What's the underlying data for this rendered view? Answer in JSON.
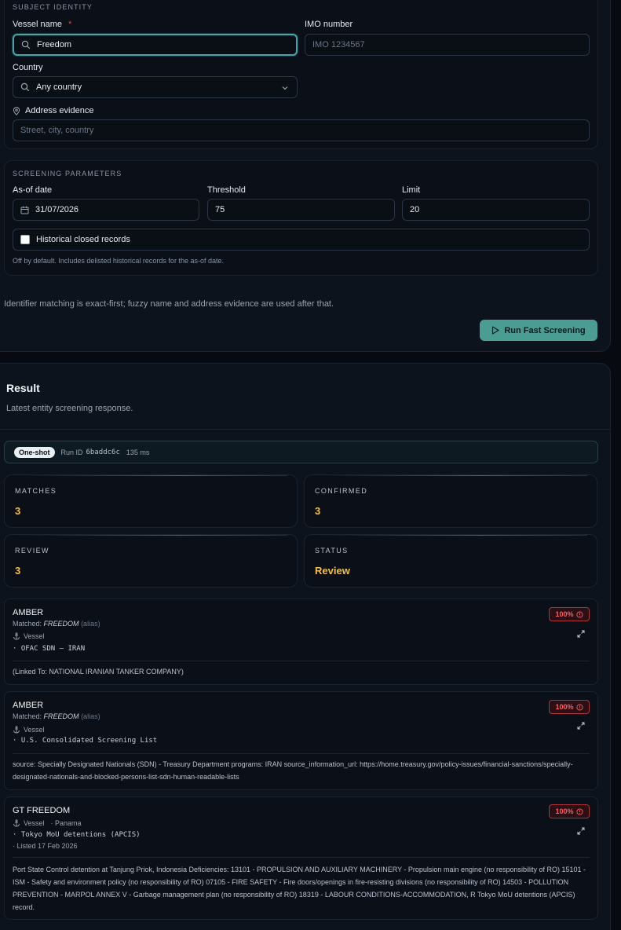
{
  "identity": {
    "section_title": "SUBJECT IDENTITY",
    "vessel_label": "Vessel name",
    "required_mark": "*",
    "vessel_value": "Freedom",
    "imo_label": "IMO number",
    "imo_placeholder": "IMO 1234567",
    "country_label": "Country",
    "country_value": "Any country",
    "address_label": "Address evidence",
    "address_placeholder": "Street, city, country"
  },
  "params": {
    "section_title": "SCREENING PARAMETERS",
    "asof_label": "As-of date",
    "asof_value": "31/07/2026",
    "threshold_label": "Threshold",
    "threshold_value": "75",
    "limit_label": "Limit",
    "limit_value": "20",
    "historical_label": "Historical closed records",
    "historical_checked": false,
    "historical_hint": "Off by default. Includes delisted historical records for the as-of date."
  },
  "note": "Identifier matching is exact-first; fuzzy name and address evidence are used after that.",
  "run_button": "Run Fast Screening",
  "result": {
    "title": "Result",
    "subtitle": "Latest entity screening response.",
    "mode": "One-shot",
    "run_id_label": "Run ID",
    "run_id": "6baddc6c",
    "duration": "135 ms",
    "stats": [
      {
        "label": "MATCHES",
        "value": "3"
      },
      {
        "label": "CONFIRMED",
        "value": "3"
      },
      {
        "label": "REVIEW",
        "value": "3"
      },
      {
        "label": "STATUS",
        "value": "Review"
      }
    ],
    "accent_color": "#f0c04a",
    "cards": [
      {
        "name": "AMBER",
        "matched_label": "Matched:",
        "matched_name": "FREEDOM",
        "matched_kind": "(alias)",
        "type": "Vessel",
        "source": "· OFAC SDN — IRAN",
        "score": "100%",
        "body": "(Linked To: NATIONAL IRANIAN TANKER COMPANY)"
      },
      {
        "name": "AMBER",
        "matched_label": "Matched:",
        "matched_name": "FREEDOM",
        "matched_kind": "(alias)",
        "type": "Vessel",
        "source": "· U.S. Consolidated Screening List",
        "score": "100%",
        "body": "source: Specially Designated Nationals (SDN) - Treasury Department programs: IRAN source_information_url: https://home.treasury.gov/policy-issues/financial-sanctions/specially-designated-nationals-and-blocked-persons-list-sdn-human-readable-lists"
      },
      {
        "name": "GT FREEDOM",
        "type": "Vessel",
        "flag": "· Panama",
        "source": "· Tokyo MoU detentions (APCIS)",
        "listed": "· Listed 17 Feb 2026",
        "score": "100%",
        "body": "Port State Control detention at Tanjung Priok, Indonesia Deficiencies: 13101 - PROPULSION AND AUXILIARY MACHINERY - Propulsion main engine (no responsibility of RO) 15101 - ISM - Safety and environment policy (no responsibility of RO) 07105 - FIRE SAFETY - Fire doors/openings in fire-resisting divisions (no responsibility of RO) 14503 - POLLUTION PREVENTION - MARPOL ANNEX V - Garbage management plan (no responsibility of RO) 18319 - LABOUR CONDITIONS-ACCOMMODATION, R Tokyo MoU detentions (APCIS) record."
      }
    ]
  }
}
